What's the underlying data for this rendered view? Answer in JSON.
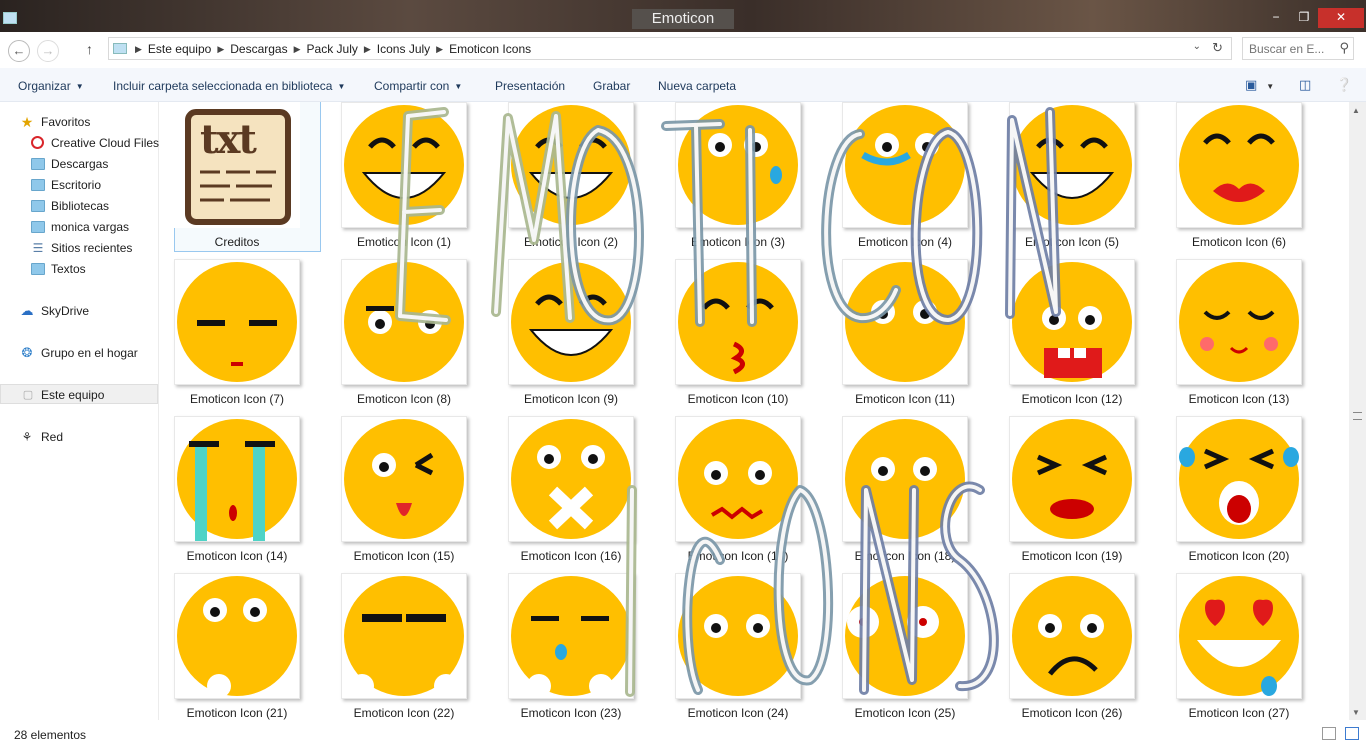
{
  "window": {
    "title": "Emoticon Icons",
    "minimize_label": "−",
    "maximize_label": "❐",
    "close_label": "✕"
  },
  "address": {
    "breadcrumbs": [
      "Este equipo",
      "Descargas",
      "Pack July",
      "Icons July",
      "Emoticon Icons"
    ],
    "search_placeholder": "Buscar en E..."
  },
  "toolbar": {
    "organize": "Organizar",
    "include": "Incluir carpeta seleccionada en biblioteca",
    "share": "Compartir con",
    "presentation": "Presentación",
    "burn": "Grabar",
    "new_folder": "Nueva carpeta"
  },
  "sidebar": {
    "favorites_header": "Favoritos",
    "favorites": [
      "Creative Cloud Files",
      "Descargas",
      "Escritorio",
      "Bibliotecas",
      "monica vargas",
      "Sitios recientes",
      "Textos"
    ],
    "skydrive": "SkyDrive",
    "homegroup": "Grupo en el hogar",
    "this_pc": "Este equipo",
    "network": "Red"
  },
  "files": [
    "Creditos",
    "Emoticon Icon (1)",
    "Emoticon Icon (2)",
    "Emoticon Icon (3)",
    "Emoticon Icon (4)",
    "Emoticon Icon (5)",
    "Emoticon Icon (6)",
    "Emoticon Icon (7)",
    "Emoticon Icon (8)",
    "Emoticon Icon (9)",
    "Emoticon Icon (10)",
    "Emoticon Icon (11)",
    "Emoticon Icon (12)",
    "Emoticon Icon (13)",
    "Emoticon Icon (14)",
    "Emoticon Icon (15)",
    "Emoticon Icon (16)",
    "Emoticon Icon (17)",
    "Emoticon Icon (18)",
    "Emoticon Icon (19)",
    "Emoticon Icon (20)",
    "Emoticon Icon (21)",
    "Emoticon Icon (22)",
    "Emoticon Icon (23)",
    "Emoticon Icon (24)",
    "Emoticon Icon (25)",
    "Emoticon Icon (26)",
    "Emoticon Icon (27)"
  ],
  "credits_thumb_text": "txt",
  "overlay_text": {
    "line1": "EMOTICON",
    "line2": "ICONS"
  },
  "status": {
    "count": "28 elementos"
  },
  "colors": {
    "emoji_yellow": "#FFBF00",
    "overlay_green": "#a9b78f",
    "overlay_blue": "#6f8fa8",
    "overlay_purple": "#6e6da6",
    "selection": "#cce8ff"
  },
  "selected_file": "Creditos"
}
